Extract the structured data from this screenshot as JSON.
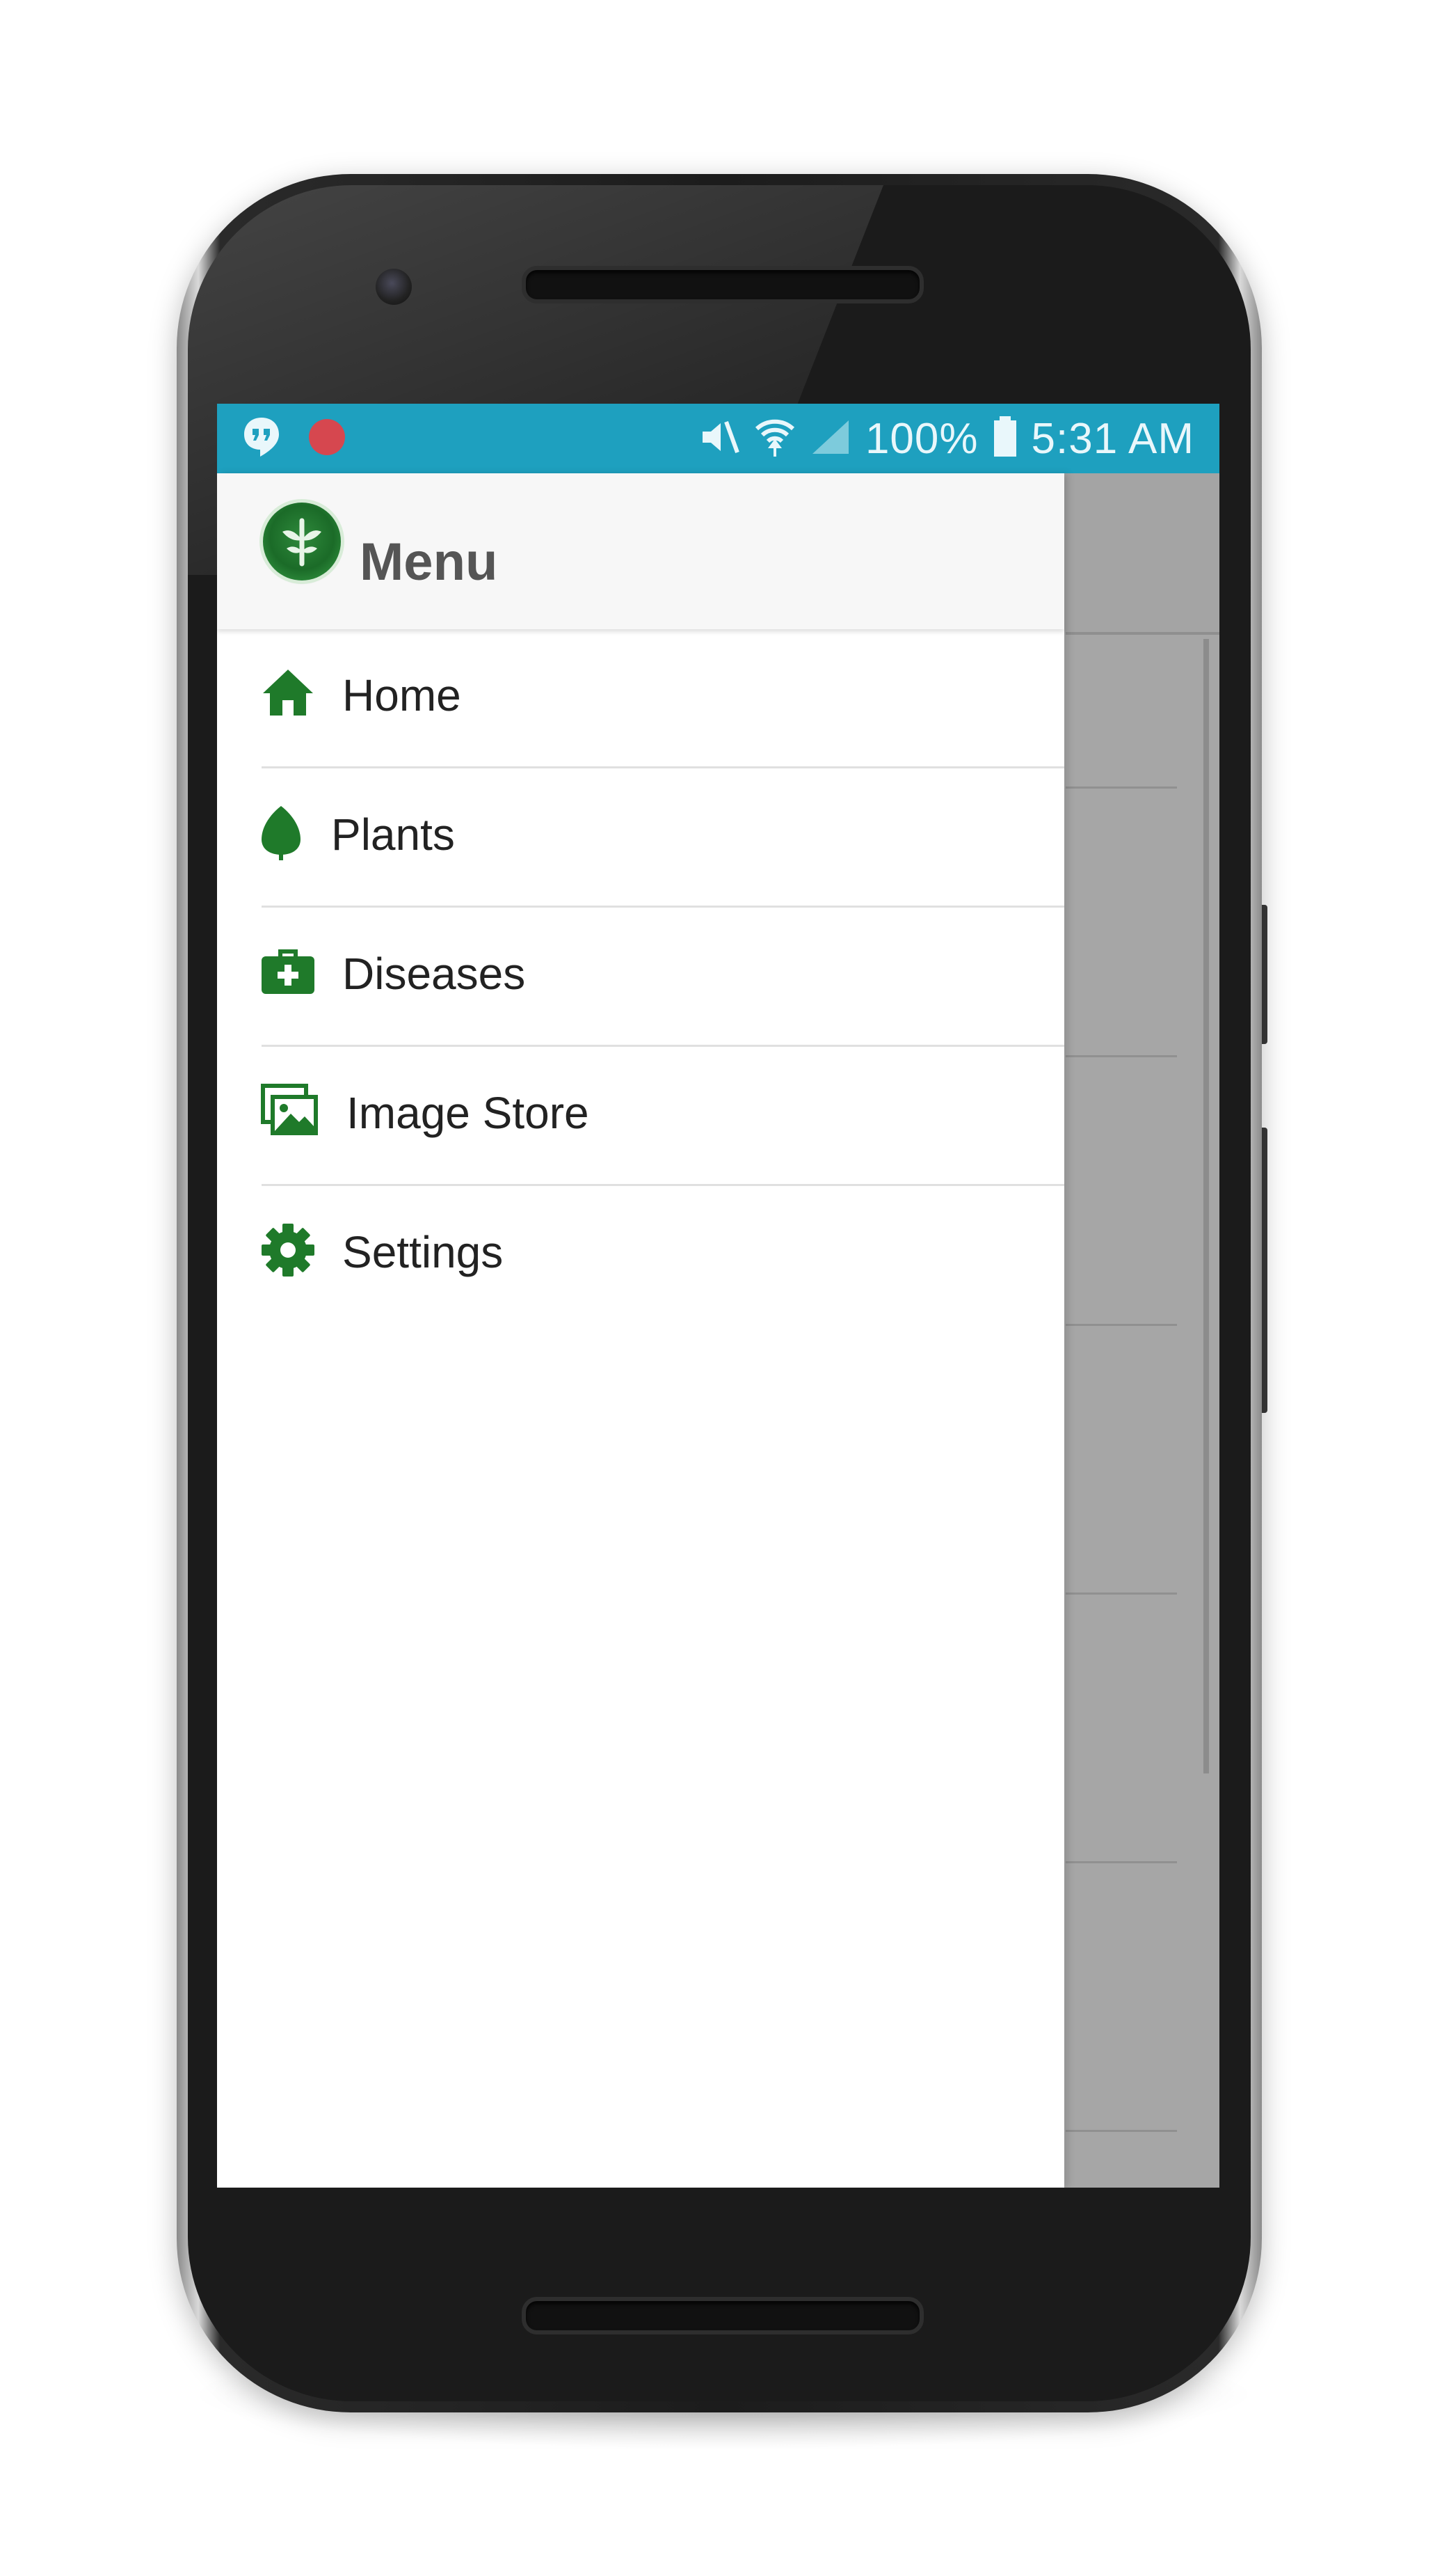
{
  "status_bar": {
    "battery": "100%",
    "time": "5:31 AM",
    "icons": [
      "hangouts-icon",
      "record-icon",
      "mute-icon",
      "wifi-icon",
      "signal-icon",
      "battery-icon"
    ]
  },
  "drawer": {
    "title": "Menu",
    "items": [
      {
        "label": "Home",
        "icon": "home-icon"
      },
      {
        "label": "Plants",
        "icon": "leaf-icon"
      },
      {
        "label": "Diseases",
        "icon": "medical-kit-icon"
      },
      {
        "label": "Image Store",
        "icon": "images-icon"
      },
      {
        "label": "Settings",
        "icon": "gear-icon"
      }
    ]
  },
  "colors": {
    "status_bar": "#1ea0bf",
    "accent_green": "#1f7a2a",
    "scrim": "#a6a6a6",
    "title_gray": "#555555"
  }
}
